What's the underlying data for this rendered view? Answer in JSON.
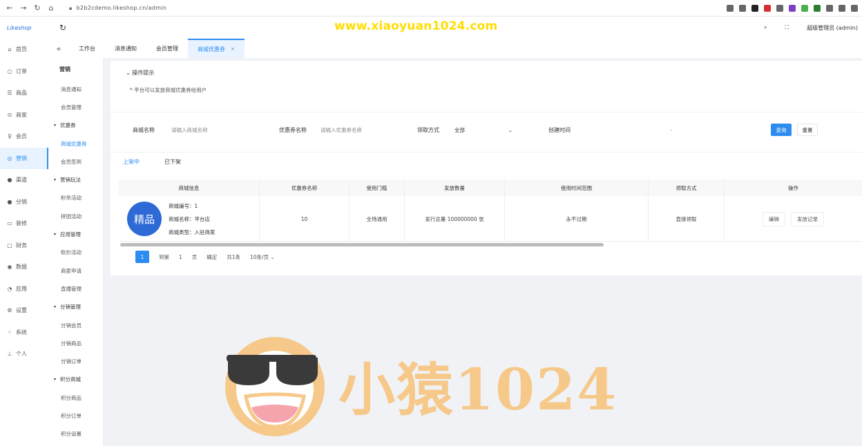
{
  "browser": {
    "url": "b2b2cdemo.likeshop.cn/admin",
    "ext_colors": [
      "#666666",
      "#666666",
      "#222222",
      "#d32f2f",
      "#666666",
      "#7b3fc4",
      "#4caf50",
      "#2e7d32",
      "#666666",
      "#666666",
      "#666666"
    ]
  },
  "header": {
    "logo": "Likeshop",
    "watermark_url": "www.xiaoyuan1024.com",
    "user": "超级管理员 (admin)"
  },
  "sidebar1": [
    {
      "label": "首页",
      "icon": "home-icon",
      "glyph": "⌂"
    },
    {
      "label": "订单",
      "icon": "order-icon",
      "glyph": "○"
    },
    {
      "label": "商品",
      "icon": "goods-icon",
      "glyph": "☰"
    },
    {
      "label": "商家",
      "icon": "shop-icon",
      "glyph": "⊙"
    },
    {
      "label": "会员",
      "icon": "user-icon",
      "glyph": "♀"
    },
    {
      "label": "营销",
      "icon": "marketing-icon",
      "glyph": "◎",
      "active": true
    },
    {
      "label": "渠道",
      "icon": "channel-icon",
      "glyph": "●"
    },
    {
      "label": "分销",
      "icon": "distribution-icon",
      "glyph": "●"
    },
    {
      "label": "装修",
      "icon": "decorate-icon",
      "glyph": "▭"
    },
    {
      "label": "财务",
      "icon": "finance-icon",
      "glyph": "▢"
    },
    {
      "label": "数据",
      "icon": "data-icon",
      "glyph": "◉"
    },
    {
      "label": "应用",
      "icon": "app-icon",
      "glyph": "◔"
    },
    {
      "label": "设置",
      "icon": "setting-icon",
      "glyph": "⚙"
    },
    {
      "label": "系统",
      "icon": "system-icon",
      "glyph": "⁘"
    },
    {
      "label": "个人",
      "icon": "person-icon",
      "glyph": "⊥"
    }
  ],
  "tabs": [
    {
      "label": "工作台"
    },
    {
      "label": "消息通知"
    },
    {
      "label": "会员管理"
    },
    {
      "label": "商城优惠券",
      "active": true
    }
  ],
  "sidebar2": {
    "title": "营销",
    "items": [
      {
        "label": "消息通知"
      },
      {
        "label": "会员管理"
      },
      {
        "label": "优惠券",
        "group": true
      },
      {
        "label": "商城优惠券",
        "active": true
      },
      {
        "label": "会员签到"
      },
      {
        "label": "营销玩法",
        "group": true
      },
      {
        "label": "秒杀活动"
      },
      {
        "label": "拼团活动"
      },
      {
        "label": "应用管理",
        "group": true
      },
      {
        "label": "砍价活动"
      },
      {
        "label": "商家申请"
      },
      {
        "label": "直播管理"
      },
      {
        "label": "分销管理",
        "group": true
      },
      {
        "label": "分销会员"
      },
      {
        "label": "分销商品"
      },
      {
        "label": "分销订单"
      },
      {
        "label": "积分商城",
        "group": true
      },
      {
        "label": "积分商品"
      },
      {
        "label": "积分订单"
      },
      {
        "label": "积分设置"
      }
    ]
  },
  "tip": {
    "title": "操作提示",
    "text": "* 平台可以发放商城优惠券给用户"
  },
  "filter": {
    "name_label": "商城名称",
    "name_placeholder": "请输入商城名称",
    "coupon_label": "优惠券名称",
    "coupon_placeholder": "请输入优惠券名称",
    "method_label": "领取方式",
    "method_value": "全部",
    "time_label": "创建时间",
    "time_sep": "-",
    "query": "查询",
    "reset": "重置"
  },
  "subtabs": [
    {
      "label": "上架中",
      "active": true
    },
    {
      "label": "已下架"
    }
  ],
  "table": {
    "columns": [
      "商城信息",
      "优惠券名称",
      "使用门槛",
      "发放数量",
      "使用时间范围",
      "领取方式",
      "操作"
    ],
    "rows": [
      {
        "badge": "精品",
        "lines": [
          "商城编号：1",
          "商城名称：平台店",
          "商城类型：入驻商家"
        ],
        "coupon": "10",
        "threshold": "全场通用",
        "count": "发行总量 100000000 张",
        "range": "永不过期",
        "method": "直接领取",
        "ops": [
          "编辑",
          "发放记录"
        ]
      }
    ]
  },
  "pager": {
    "current": "1",
    "goto": "到第",
    "page": "1",
    "confirm": "确定",
    "total": "共1条",
    "page_size": "10条/页"
  },
  "watermark": {
    "text": "小猿1024"
  }
}
